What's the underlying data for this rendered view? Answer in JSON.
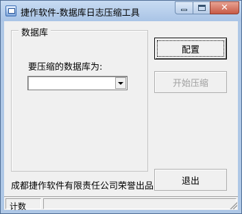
{
  "window": {
    "title": "捷作软件-数据库日志压缩工具"
  },
  "group": {
    "label": "数据库",
    "prompt": "要压缩的数据库为:",
    "combo_value": ""
  },
  "buttons": {
    "config": "配置",
    "compress": "开始压缩",
    "exit": "退出"
  },
  "footer": {
    "credit": "成都捷作软件有限责任公司荣誉出品"
  },
  "statusbar": {
    "pane1": "计数",
    "pane2": ""
  },
  "icons": {
    "app": "app-icon",
    "minimize": "minimize-icon",
    "maximize": "maximize-icon",
    "close": "close-icon",
    "dropdown": "chevron-down-icon",
    "grip": "resize-grip-icon"
  },
  "colors": {
    "titlebar": "#aec7e6",
    "close_button": "#c75a46",
    "dialog_bg": "#f0f0f0",
    "disabled_text": "#a0a0a0"
  }
}
